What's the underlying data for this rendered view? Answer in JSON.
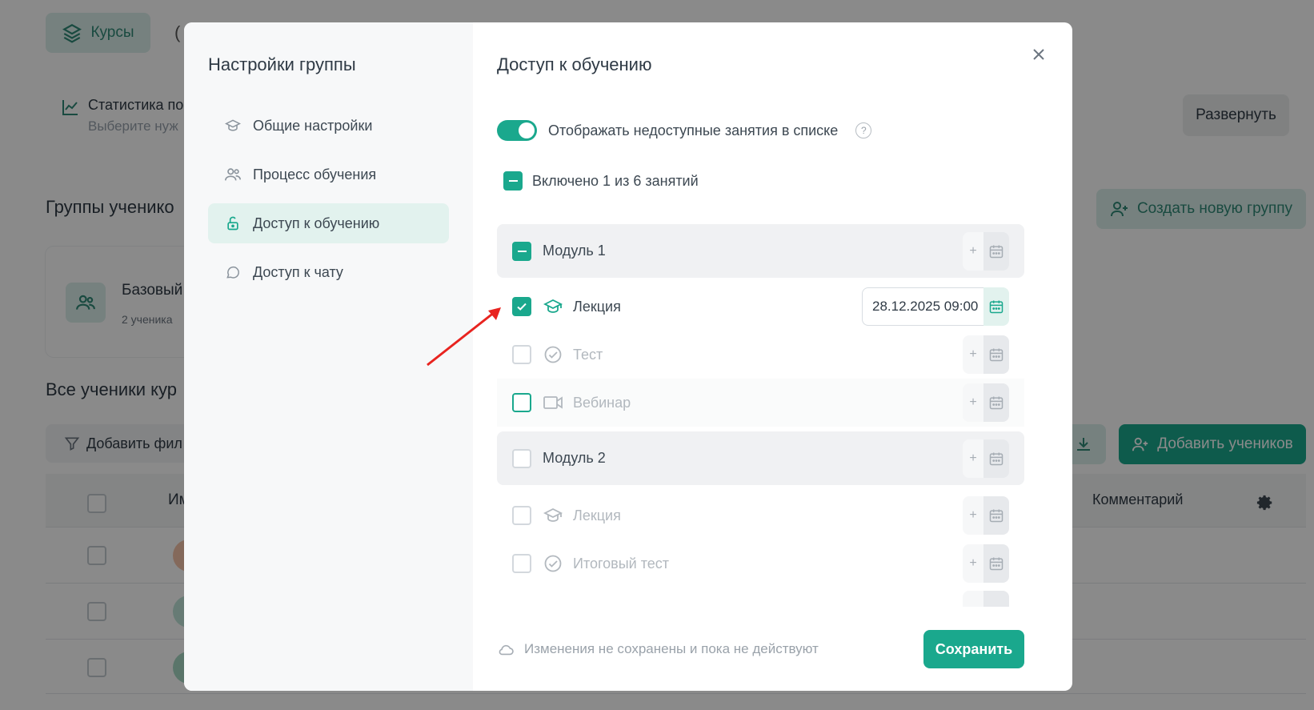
{
  "background": {
    "courses_tab": "Курсы",
    "paren": "(",
    "stats_title": "Статистика по",
    "stats_sub": "Выберите нуж",
    "expand_button": "Развернуть",
    "groups_title": "Группы ученико",
    "create_group_button": "Создать новую группу",
    "group_card": {
      "name": "Базовый",
      "count": "2 ученика"
    },
    "all_students_title": "Все ученики кур",
    "filter_button": "Добавить фил",
    "add_students_button": "Добавить учеников",
    "table": {
      "col_name": "Им",
      "col_comment": "Комментарий"
    }
  },
  "modal": {
    "sidebar_title": "Настройки группы",
    "nav": [
      {
        "label": "Общие настройки",
        "icon": "graduation-cap-icon"
      },
      {
        "label": "Процесс обучения",
        "icon": "users-icon"
      },
      {
        "label": "Доступ к обучению",
        "icon": "lock-open-icon",
        "active": true
      },
      {
        "label": "Доступ к чату",
        "icon": "chat-icon"
      }
    ],
    "title": "Доступ к обучению",
    "toggle_label": "Отображать недоступные занятия в списке",
    "toggle_on": true,
    "help_glyph": "?",
    "included_label": "Включено 1 из 6 занятий",
    "list": [
      {
        "type": "module",
        "label": "Модуль 1",
        "state": "partial"
      },
      {
        "type": "lesson",
        "label": "Лекция",
        "icon": "graduation-cap-icon",
        "checked": true,
        "date": "28.12.2025 09:00"
      },
      {
        "type": "lesson",
        "label": "Тест",
        "icon": "check-circle-icon",
        "checked": false
      },
      {
        "type": "lesson",
        "label": "Вебинар",
        "icon": "video-icon",
        "checked": false,
        "hover": true
      },
      {
        "type": "module",
        "label": "Модуль 2",
        "state": "none"
      },
      {
        "type": "lesson",
        "label": "Лекция",
        "icon": "graduation-cap-icon",
        "checked": false
      },
      {
        "type": "lesson",
        "label": "Итоговый тест",
        "icon": "check-circle-icon",
        "checked": false
      }
    ],
    "plus_glyph": "+",
    "footer_note": "Изменения не сохранены и пока не действуют",
    "save_button": "Сохранить"
  },
  "colors": {
    "accent": "#1aa88d",
    "accent_light": "#e2f2ee",
    "annotation_arrow": "#e8231f"
  }
}
